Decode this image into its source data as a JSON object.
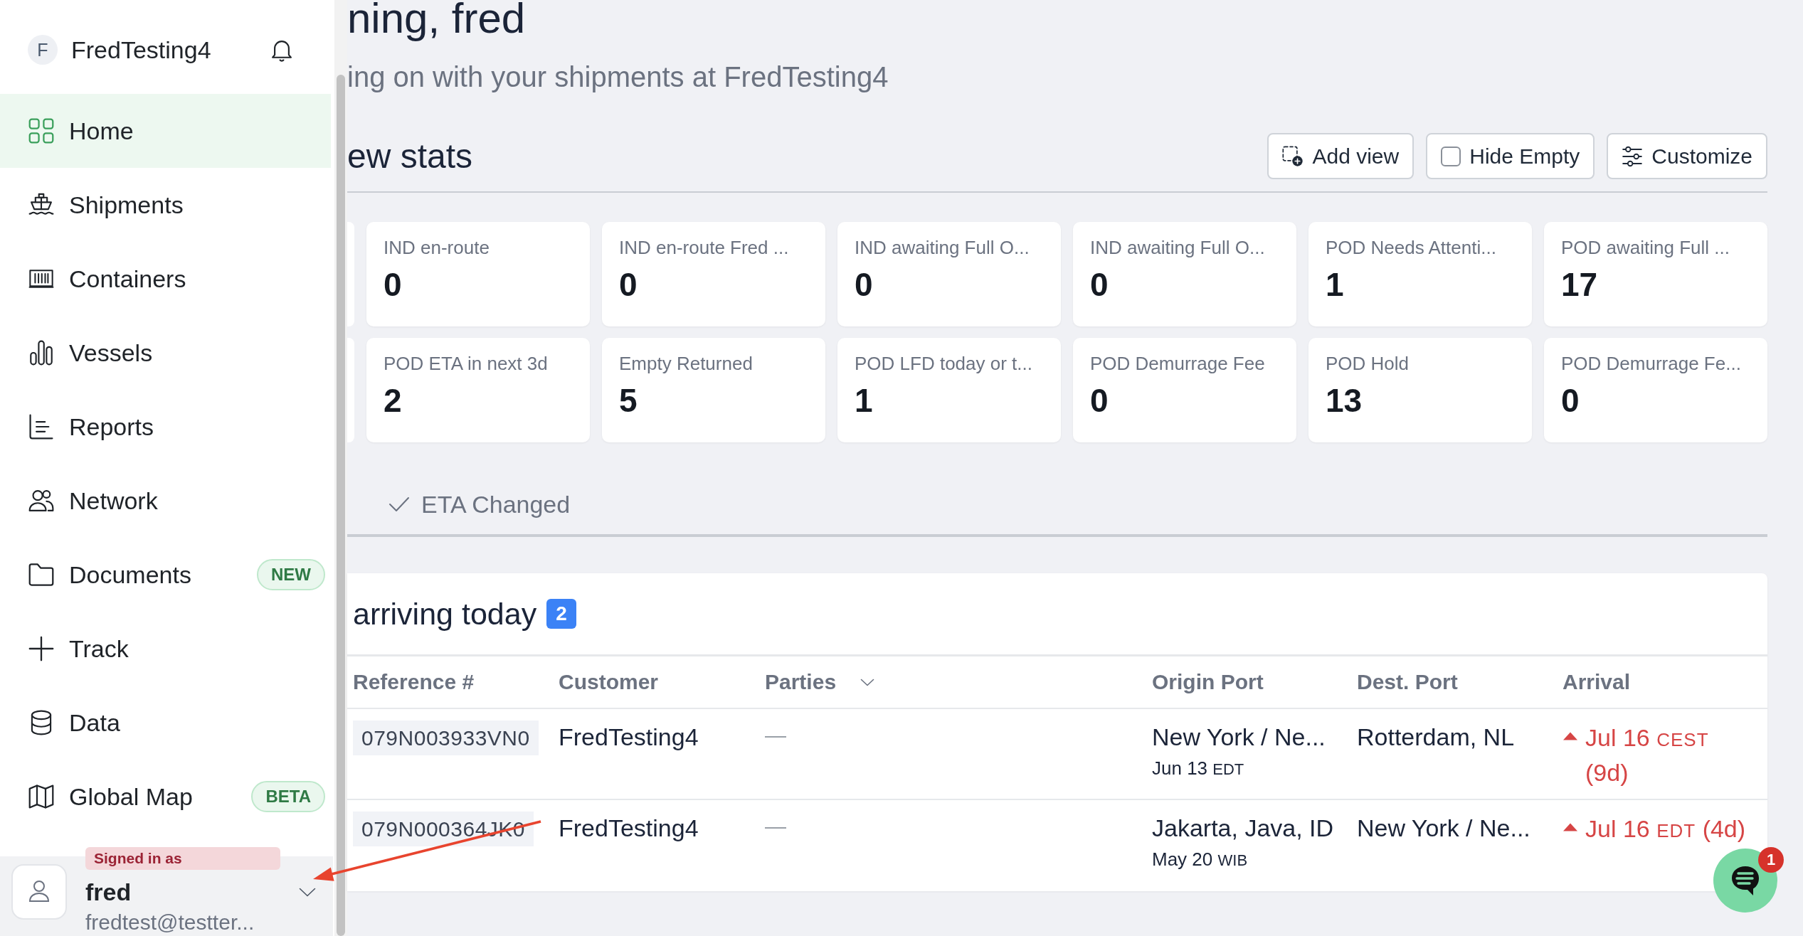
{
  "sidebar": {
    "org": {
      "initial": "F",
      "name": "FredTesting4"
    },
    "nav": [
      {
        "label": "Home",
        "selected": true
      },
      {
        "label": "Shipments",
        "selected": false
      },
      {
        "label": "Containers",
        "selected": false
      },
      {
        "label": "Vessels",
        "selected": false
      },
      {
        "label": "Reports",
        "selected": false
      },
      {
        "label": "Network",
        "selected": false
      },
      {
        "label": "Documents",
        "selected": false,
        "badge": "NEW"
      },
      {
        "label": "Track",
        "selected": false
      },
      {
        "label": "Data",
        "selected": false
      },
      {
        "label": "Global Map",
        "selected": false,
        "badge": "BETA"
      }
    ],
    "user": {
      "caption": "Signed in as",
      "name": "fred",
      "email": "fredtest@testter..."
    }
  },
  "header": {
    "title": "ning, fred",
    "subtitle": "ing on with your shipments at FredTesting4"
  },
  "stats": {
    "heading": "ew stats",
    "buttons": [
      {
        "kind": "button",
        "label": "Add view"
      },
      {
        "kind": "checkbox",
        "label": "Hide Empty",
        "checked": false
      },
      {
        "kind": "button",
        "label": "Customize"
      }
    ],
    "cards": [
      {
        "label": "IND en-route",
        "value": "0"
      },
      {
        "label": "IND en-route Fred ...",
        "value": "0"
      },
      {
        "label": "IND awaiting Full O...",
        "value": "0"
      },
      {
        "label": "IND awaiting Full O...",
        "value": "0"
      },
      {
        "label": "POD Needs Attenti...",
        "value": "1"
      },
      {
        "label": "POD awaiting Full ...",
        "value": "17"
      },
      {
        "label": "POD ETA in next 3d",
        "value": "2"
      },
      {
        "label": "Empty Returned",
        "value": "5"
      },
      {
        "label": "POD LFD today or t...",
        "value": "1"
      },
      {
        "label": "POD Demurrage Fee",
        "value": "0"
      },
      {
        "label": "POD Hold",
        "value": "13"
      },
      {
        "label": "POD Demurrage Fe...",
        "value": "0"
      }
    ]
  },
  "tabs": [
    {
      "label": "ETA Changed",
      "checked": true
    }
  ],
  "arrivals": {
    "title": "arriving today",
    "count": "2",
    "columns": [
      {
        "label": "Reference #",
        "menu": false
      },
      {
        "label": "Customer",
        "menu": false
      },
      {
        "label": "Parties",
        "menu": true
      },
      {
        "label": "Origin Port",
        "menu": false
      },
      {
        "label": "Dest. Port",
        "menu": false
      },
      {
        "label": "Arrival",
        "menu": false
      }
    ],
    "rows": [
      {
        "reference": "079N003933VN0",
        "customer": "FredTesting4",
        "parties": "—",
        "origin": {
          "port": "New York / Ne...",
          "date": "Jun 13",
          "zone": "EDT"
        },
        "destination": "Rotterdam, NL",
        "arrival": {
          "delayed": true,
          "date": "Jul 16",
          "zone": "CEST",
          "relative": "(9d)"
        }
      },
      {
        "reference": "079N000364JK0",
        "customer": "FredTesting4",
        "parties": "—",
        "origin": {
          "port": "Jakarta, Java, ID",
          "date": "May 20",
          "zone": "WIB"
        },
        "destination": "New York / Ne...",
        "arrival": {
          "delayed": true,
          "date": "Jul 16",
          "zone": "EDT",
          "relative": "(4d)"
        }
      }
    ]
  },
  "chat": {
    "badge": "1"
  }
}
